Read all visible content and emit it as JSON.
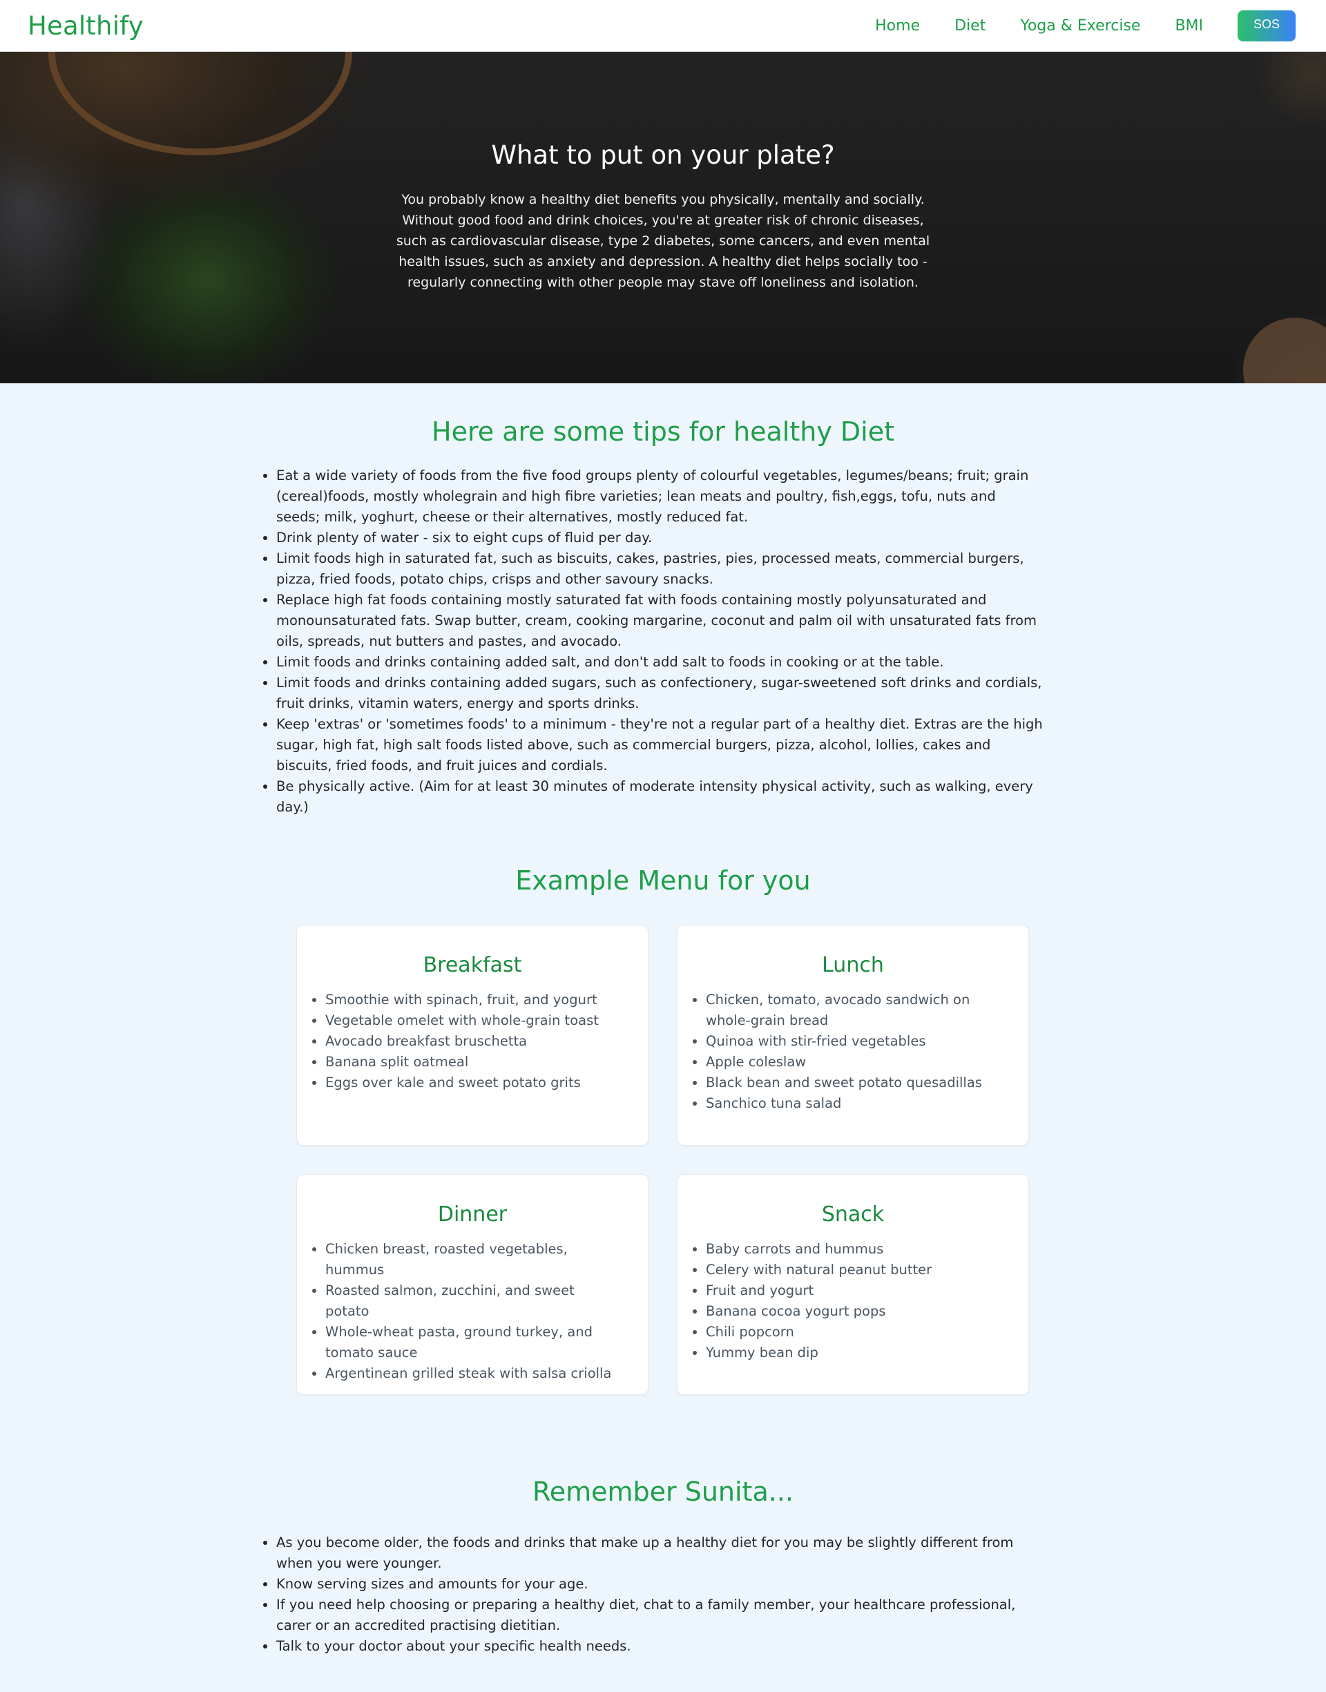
{
  "navbar": {
    "brand": "Healthify",
    "links": [
      "Home",
      "Diet",
      "Yoga & Exercise",
      "BMI"
    ],
    "sos_label": "SOS"
  },
  "hero": {
    "title": "What to put on your plate?",
    "text": "You probably know a healthy diet benefits you physically, mentally and socially. Without good food and drink choices, you're at greater risk of chronic diseases, such as cardiovascular disease, type 2 diabetes, some cancers, and even mental health issues, such as anxiety and depression. A healthy diet helps socially too - regularly connecting with other people may stave off loneliness and isolation."
  },
  "tips": {
    "title": "Here are some tips for healthy Diet",
    "items": [
      "Eat a wide variety of foods from the five food groups plenty of colourful vegetables, legumes/beans; fruit; grain (cereal)foods, mostly wholegrain and high fibre varieties; lean meats and poultry, fish,eggs, tofu, nuts and seeds; milk, yoghurt, cheese or their alternatives, mostly reduced fat.",
      "Drink plenty of water - six to eight cups of fluid per day.",
      "Limit foods high in saturated fat, such as biscuits, cakes, pastries, pies, processed meats, commercial burgers, pizza, fried foods, potato chips, crisps and other savoury snacks.",
      "Replace high fat foods containing mostly saturated fat with foods containing mostly polyunsaturated and monounsaturated fats. Swap butter, cream, cooking margarine, coconut and palm oil with unsaturated fats from oils, spreads, nut butters and pastes, and avocado.",
      "Limit foods and drinks containing added salt, and don't add salt to foods in cooking or at the table.",
      "Limit foods and drinks containing added sugars, such as confectionery, sugar-sweetened soft drinks and cordials, fruit drinks, vitamin waters, energy and sports drinks.",
      "Keep 'extras' or 'sometimes foods' to a minimum - they're not a regular part of a healthy diet. Extras are the high sugar, high fat, high salt foods listed above, such as commercial burgers, pizza, alcohol, lollies, cakes and biscuits, fried foods, and fruit juices and cordials.",
      "Be physically active. (Aim for at least 30 minutes of moderate intensity physical activity, such as walking, every day.)"
    ]
  },
  "menu": {
    "title": "Example Menu for you",
    "cards": [
      {
        "title": "Breakfast",
        "items": [
          "Smoothie with spinach, fruit, and yogurt",
          "Vegetable omelet with whole-grain toast",
          "Avocado breakfast bruschetta",
          "Banana split oatmeal",
          "Eggs over kale and sweet potato grits"
        ]
      },
      {
        "title": "Lunch",
        "items": [
          "Chicken, tomato, avocado sandwich on whole-grain bread",
          "Quinoa with stir-fried vegetables",
          "Apple coleslaw",
          "Black bean and sweet potato quesadillas",
          "Sanchico tuna salad"
        ]
      },
      {
        "title": "Dinner",
        "items": [
          "Chicken breast, roasted vegetables, hummus",
          "Roasted salmon, zucchini, and sweet potato",
          "Whole-wheat pasta, ground turkey, and tomato sauce",
          "Argentinean grilled steak with salsa criolla"
        ]
      },
      {
        "title": "Snack",
        "items": [
          "Baby carrots and hummus",
          "Celery with natural peanut butter",
          "Fruit and yogurt",
          "Banana cocoa yogurt pops",
          "Chili popcorn",
          "Yummy bean dip"
        ]
      }
    ]
  },
  "remember": {
    "title": "Remember Sunita...",
    "items": [
      "As you become older, the foods and drinks that make up a healthy diet for you may be slightly different from when you were younger.",
      "Know serving sizes and amounts for your age.",
      "If you need help choosing or preparing a healthy diet, chat to a family member, your healthcare professional, carer or an accredited practising dietitian.",
      "Talk to your doctor about your specific health needs."
    ]
  }
}
